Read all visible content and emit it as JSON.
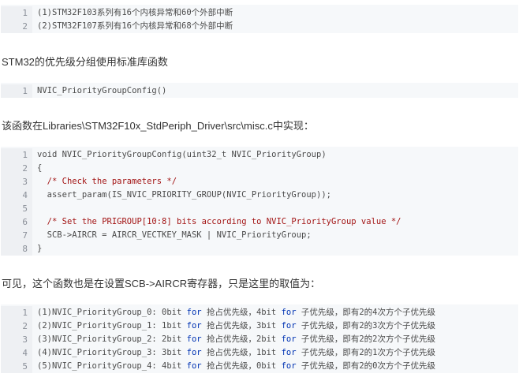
{
  "block1": {
    "lines": [
      "(1)STM32F103系列有16个内核异常和60个外部中断",
      "(2)STM32F107系列有16个内核异常和68个外部中断"
    ]
  },
  "para1": "STM32的优先级分组使用标准库函数",
  "block2": {
    "lines": [
      "NVIC_PriorityGroupConfig()"
    ]
  },
  "para2": "该函数在Libraries\\STM32F10x_StdPeriph_Driver\\src\\misc.c中实现：",
  "block3": {
    "lines": [
      [
        {
          "t": "void NVIC_PriorityGroupConfig(uint32_t NVIC_PriorityGroup)"
        }
      ],
      [
        {
          "t": "{"
        }
      ],
      [
        {
          "t": "  "
        },
        {
          "t": "/* Check the parameters */",
          "c": "cm"
        }
      ],
      [
        {
          "t": "  assert_param(IS_NVIC_PRIORITY_GROUP(NVIC_PriorityGroup));"
        }
      ],
      [
        {
          "t": ""
        }
      ],
      [
        {
          "t": "  "
        },
        {
          "t": "/* Set the PRIGROUP[10:8] bits according to NVIC_PriorityGroup value */",
          "c": "cm"
        }
      ],
      [
        {
          "t": "  SCB->AIRCR = AIRCR_VECTKEY_MASK | NVIC_PriorityGroup;"
        }
      ],
      [
        {
          "t": "}"
        }
      ]
    ]
  },
  "para3": "可见，这个函数也是在设置SCB->AIRCR寄存器，只是这里的取值为：",
  "block4": {
    "lines": [
      [
        {
          "t": "(1)NVIC_PriorityGroup_0: 0bit "
        },
        {
          "t": "for",
          "c": "kw"
        },
        {
          "t": " 抢占优先级，4bit "
        },
        {
          "t": "for",
          "c": "kw"
        },
        {
          "t": " 子优先级，即有2的4次方个子优先级"
        }
      ],
      [
        {
          "t": "(2)NVIC_PriorityGroup_1: 1bit "
        },
        {
          "t": "for",
          "c": "kw"
        },
        {
          "t": " 抢占优先级，3bit "
        },
        {
          "t": "for",
          "c": "kw"
        },
        {
          "t": " 子优先级，即有2的3次方个子优先级"
        }
      ],
      [
        {
          "t": "(3)NVIC_PriorityGroup_2: 2bit "
        },
        {
          "t": "for",
          "c": "kw"
        },
        {
          "t": " 抢占优先级，2bit "
        },
        {
          "t": "for",
          "c": "kw"
        },
        {
          "t": " 子优先级，即有2的2次方个子优先级"
        }
      ],
      [
        {
          "t": "(4)NVIC_PriorityGroup_3: 3bit "
        },
        {
          "t": "for",
          "c": "kw"
        },
        {
          "t": " 抢占优先级，1bit "
        },
        {
          "t": "for",
          "c": "kw"
        },
        {
          "t": " 子优先级，即有2的1次方个子优先级"
        }
      ],
      [
        {
          "t": "(5)NVIC_PriorityGroup_4: 4bit "
        },
        {
          "t": "for",
          "c": "kw"
        },
        {
          "t": " 抢占优先级，0bit "
        },
        {
          "t": "for",
          "c": "kw"
        },
        {
          "t": " 子优先级，即有2的0次方个子优先级"
        }
      ]
    ]
  }
}
